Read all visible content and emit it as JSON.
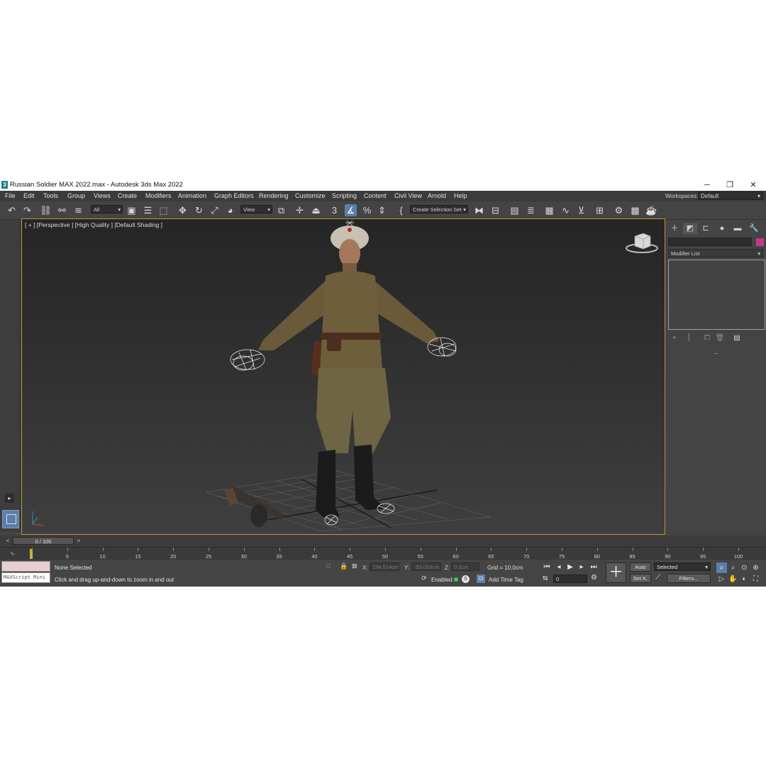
{
  "window": {
    "app_icon": "3",
    "title": "Russian Soldier MAX 2022.max - Autodesk 3ds Max 2022",
    "controls": {
      "minimize": "─",
      "maximize": "❐",
      "close": "✕"
    }
  },
  "menu": {
    "items": [
      "File",
      "Edit",
      "Tools",
      "Group",
      "Views",
      "Create",
      "Modifiers",
      "Animation",
      "Graph Editors",
      "Rendering",
      "Customize",
      "Scripting",
      "Content",
      "Civil View",
      "Arnold",
      "Help"
    ],
    "workspaces_label": "Workspaces:",
    "workspaces_value": "Default"
  },
  "toolbar": {
    "selection_filter": "All",
    "reference_coord": "View",
    "named_selection": "Create Selection Set"
  },
  "viewport": {
    "label": "[ + ] [Perspective ] [High Quality ] [Default Shading ]"
  },
  "command_panel": {
    "modifier_list": "Modifier List"
  },
  "time_slider": {
    "position": "0 / 100",
    "prev": "<",
    "next": ">"
  },
  "trackbar": {
    "ticks": [
      "5",
      "10",
      "15",
      "20",
      "25",
      "30",
      "35",
      "40",
      "45",
      "50",
      "55",
      "60",
      "65",
      "70",
      "75",
      "80",
      "85",
      "90",
      "95",
      "100"
    ]
  },
  "status": {
    "listener": "MAXScript Mini",
    "selection": "None Selected",
    "prompt": "Click and drag up-and-down to zoom in and out",
    "x_label": "X:",
    "x_value": "234,514cm",
    "y_label": "Y:",
    "y_value": "-53,053cm",
    "z_label": "Z:",
    "z_value": "0,0cm",
    "grid": "Grid = 10,0cm",
    "enabled": "Enabled:",
    "add_time_tag": "Add Time Tag",
    "frame": "0",
    "auto_key": "Auto",
    "set_key": "Set K.",
    "key_filter": "Selected",
    "filters": "Filters..."
  },
  "colors": {
    "viewport_border": "#b8962e",
    "active_tool": "#5a7fa8",
    "object_color": "#c8388a",
    "listener_top": "#e9cfd2"
  }
}
